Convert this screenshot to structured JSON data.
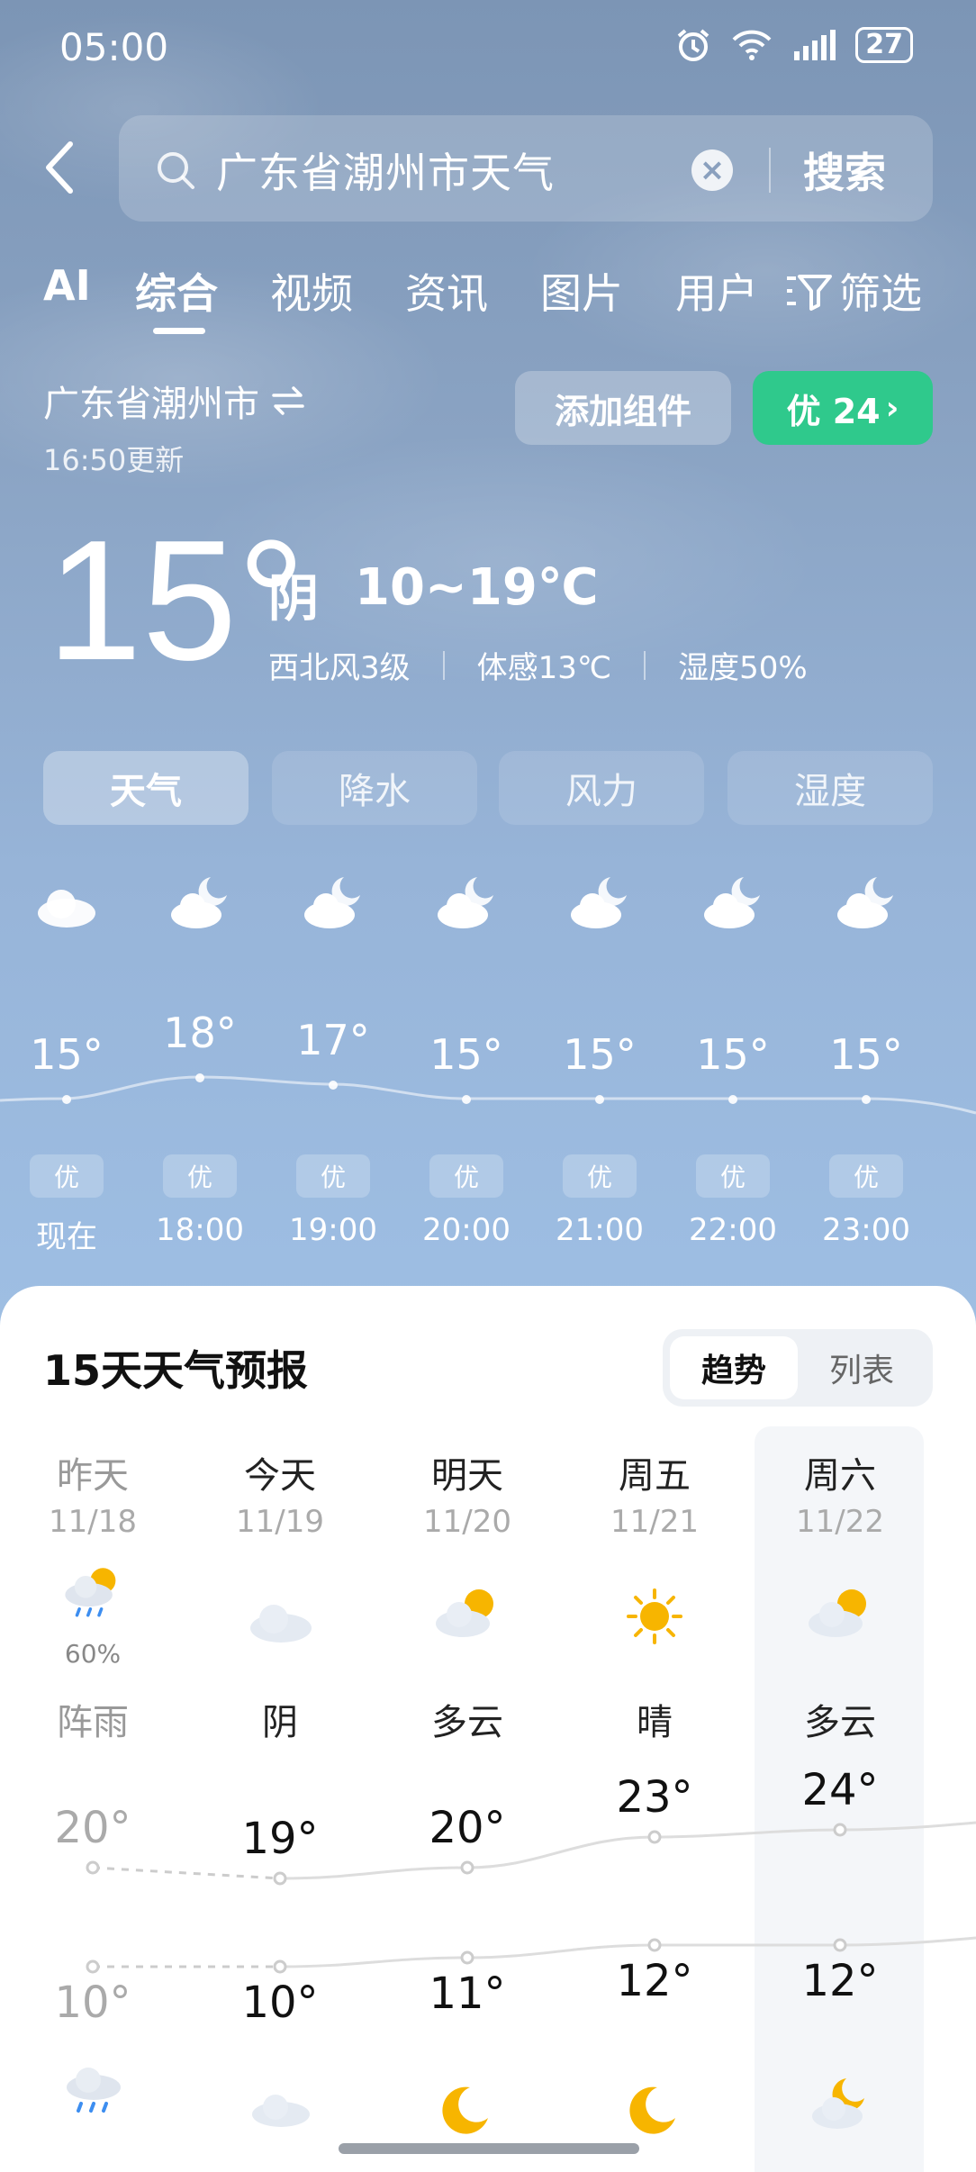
{
  "status_bar": {
    "time": "05:00",
    "battery": "27"
  },
  "search": {
    "query": "广东省潮州市天气",
    "button": "搜索"
  },
  "tabs": [
    "AI",
    "综合",
    "视频",
    "资讯",
    "图片",
    "用户"
  ],
  "filter_label": "筛选",
  "location": {
    "name": "广东省潮州市",
    "updated": "16:50更新"
  },
  "actions": {
    "add_widget": "添加组件",
    "aqi": "优 24"
  },
  "current": {
    "temp": "15°",
    "condition": "阴",
    "range": "10~19℃",
    "wind": "西北风3级",
    "feels_like": "体感13℃",
    "humidity": "湿度50%"
  },
  "segments": [
    "天气",
    "降水",
    "风力",
    "湿度"
  ],
  "hourly": [
    {
      "time": "现在",
      "temp": "15°",
      "aq": "优",
      "icon": "cloud-icon"
    },
    {
      "time": "18:00",
      "temp": "18°",
      "aq": "优",
      "icon": "cloudy-night-icon"
    },
    {
      "time": "19:00",
      "temp": "17°",
      "aq": "优",
      "icon": "cloudy-night-icon"
    },
    {
      "time": "20:00",
      "temp": "15°",
      "aq": "优",
      "icon": "cloudy-night-icon"
    },
    {
      "time": "21:00",
      "temp": "15°",
      "aq": "优",
      "icon": "cloudy-night-icon"
    },
    {
      "time": "22:00",
      "temp": "15°",
      "aq": "优",
      "icon": "cloudy-night-icon"
    },
    {
      "time": "23:00",
      "temp": "15°",
      "aq": "优",
      "icon": "cloudy-night-icon"
    }
  ],
  "forecast": {
    "title": "15天天气预报",
    "toggle": {
      "trend": "趋势",
      "list": "列表"
    },
    "days": [
      {
        "name": "昨天",
        "date": "11/18",
        "cond": "阵雨",
        "high": "20°",
        "low": "10°",
        "precip": "60%",
        "icon": "shower-icon"
      },
      {
        "name": "今天",
        "date": "11/19",
        "cond": "阴",
        "high": "19°",
        "low": "10°",
        "icon": "cloud-icon"
      },
      {
        "name": "明天",
        "date": "11/20",
        "cond": "多云",
        "high": "20°",
        "low": "11°",
        "icon": "partly-cloudy-icon"
      },
      {
        "name": "周五",
        "date": "11/21",
        "cond": "晴",
        "high": "23°",
        "low": "12°",
        "icon": "sun-icon"
      },
      {
        "name": "周六",
        "date": "11/22",
        "cond": "多云",
        "high": "24°",
        "low": "12°",
        "icon": "partly-cloudy-icon"
      }
    ]
  },
  "colors": {
    "accent_green": "#2fc98c",
    "sky": "#97b4d8"
  }
}
